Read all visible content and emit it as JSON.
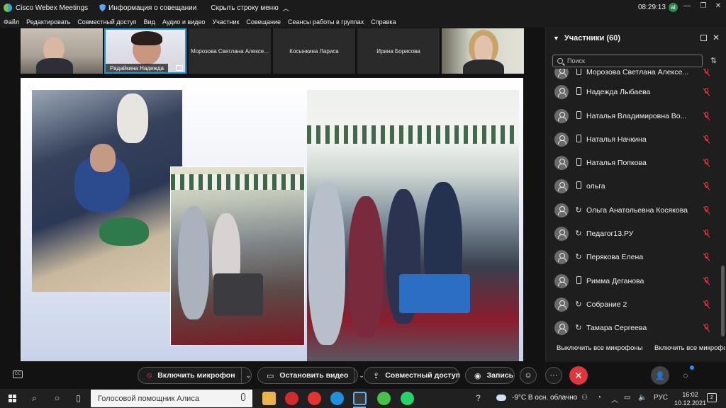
{
  "titlebar": {
    "app_name": "Cisco Webex Meetings",
    "meeting_info": "Информация о совещании",
    "hide_bar": "Скрыть строку меню",
    "time": "08:29:13",
    "badge": "al",
    "minimize": "—",
    "restore": "❐",
    "close": "✕"
  },
  "menu": [
    "Файл",
    "Редактировать",
    "Совместный доступ",
    "Вид",
    "Аудио и видео",
    "Участник",
    "Совещание",
    "Сеансы работы в группах",
    "Справка"
  ],
  "video_strip": {
    "tiles": [
      {
        "label": ""
      },
      {
        "label": "Радайкина Надежда"
      },
      {
        "label": "Морозова Светлана Алексе..."
      },
      {
        "label": "Косынкина Лариса"
      },
      {
        "label": "Ирина Борисова"
      },
      {
        "label": ""
      }
    ]
  },
  "participants": {
    "title": "Участники (60)",
    "search_placeholder": "Поиск",
    "items": [
      {
        "name": "Морозова Светлана Алексе...",
        "device": "phone"
      },
      {
        "name": "Надежда Лыбаева",
        "device": "phone"
      },
      {
        "name": "Наталья Владимировна Во...",
        "device": "phone"
      },
      {
        "name": "Наталья Начкина",
        "device": "phone"
      },
      {
        "name": "Наталья Попкова",
        "device": "phone"
      },
      {
        "name": "ольга",
        "device": "phone"
      },
      {
        "name": "Ольга Анатольевна Косякова",
        "device": "sync"
      },
      {
        "name": "Педагог13.РУ",
        "device": "sync"
      },
      {
        "name": "Перякова Елена",
        "device": "sync"
      },
      {
        "name": "Римма Деганова",
        "device": "phone"
      },
      {
        "name": "Собрание 2",
        "device": "sync"
      },
      {
        "name": "Тамара Сергеева",
        "device": "sync"
      }
    ],
    "mute_all": "Выключить все микрофоны",
    "mute_all_2": "Включить все микрофоны"
  },
  "controls": {
    "unmute": "Включить микрофон",
    "stop_video": "Остановить видео",
    "share": "Совместный доступ",
    "record": "Запись",
    "more": "···",
    "end": "✕"
  },
  "taskbar": {
    "search_text": "Голосовой помощник Алиса",
    "weather": "-9°C  В осн. облачно",
    "lang": "РУС",
    "time": "16:02",
    "date": "10.12.2021",
    "notifications": "2"
  },
  "colors": {
    "accent_blue": "#1a9bd8",
    "end_red": "#e0353f",
    "muted_red": "#e0454f"
  }
}
